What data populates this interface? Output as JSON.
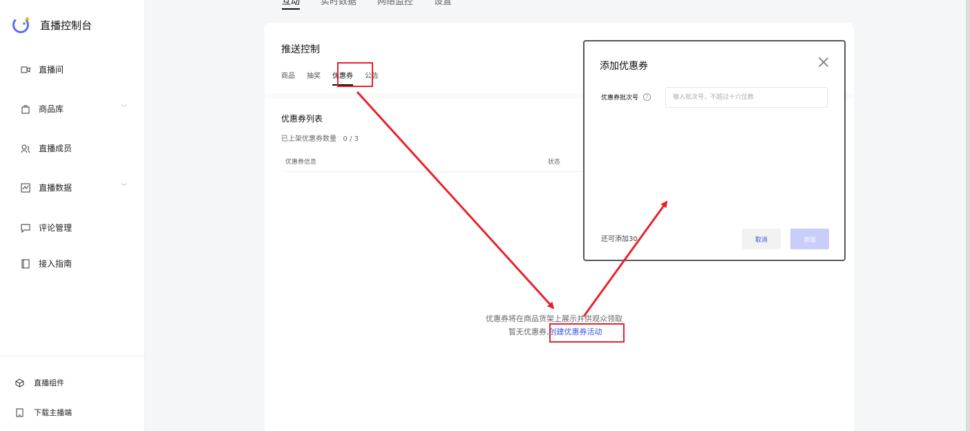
{
  "sidebar": {
    "title": "直播控制台",
    "items": [
      {
        "label": "直播间",
        "icon": "video-camera-icon"
      },
      {
        "label": "商品库",
        "icon": "shopping-bag-icon"
      },
      {
        "label": "直播成员",
        "icon": "users-icon"
      },
      {
        "label": "直播数据",
        "icon": "chart-icon"
      },
      {
        "label": "评论管理",
        "icon": "comment-icon"
      },
      {
        "label": "接入指南",
        "icon": "book-icon"
      }
    ],
    "footer": [
      {
        "label": "直播组件",
        "icon": "cube-icon"
      },
      {
        "label": "下载主播端",
        "icon": "phone-icon"
      }
    ]
  },
  "top_tabs": [
    "互动",
    "实时数据",
    "网络监控",
    "设置"
  ],
  "card": {
    "title": "推送控制",
    "sub_tabs": [
      "商品",
      "抽奖",
      "优惠券",
      "公告"
    ],
    "list_title": "优惠券列表",
    "count_label": "已上架优惠券数量",
    "count_value": "0 / 3",
    "columns": [
      "优惠券信息",
      "状态"
    ],
    "empty_line1": "优惠券将在商品货架上展示并供观众领取",
    "empty_line2_prefix": "暂无优惠券,",
    "empty_link": "创建优惠券活动"
  },
  "modal": {
    "title": "添加优惠券",
    "field_label": "优惠券批次号",
    "field_placeholder": "输入批次号，不超过十六位数",
    "remaining": "还可添加30",
    "cancel_label": "取消",
    "add_label": "添加"
  },
  "colors": {
    "accent": "#3b56d6",
    "annotation": "#e8202a"
  }
}
